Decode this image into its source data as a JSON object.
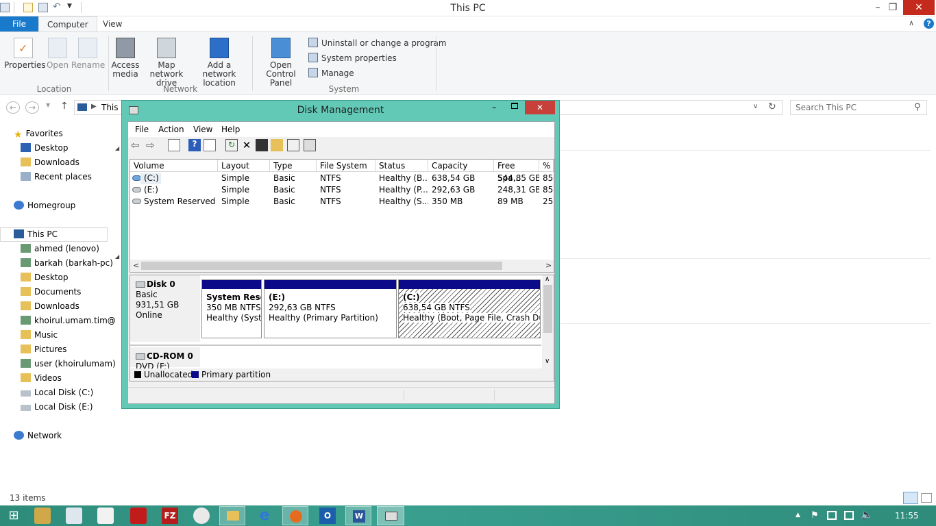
{
  "window": {
    "title": "This PC"
  },
  "window_controls": {
    "minimize": "–",
    "maximize": "❐",
    "close": "✕"
  },
  "ribbon": {
    "tabs": [
      "File",
      "Computer",
      "View"
    ],
    "location_group": {
      "label": "Location",
      "properties": "Properties",
      "open": "Open",
      "rename": "Rename"
    },
    "network_group": {
      "label": "Network",
      "access_media": "Access media",
      "map_drive": "Map network drive",
      "add_location": "Add a network location"
    },
    "system_group": {
      "label": "System",
      "open_control_panel": "Open Control Panel",
      "uninstall": "Uninstall or change a program",
      "system_properties": "System properties",
      "manage": "Manage"
    }
  },
  "address": {
    "path": "This P",
    "search_placeholder": "Search This PC"
  },
  "nav": {
    "favorites": "Favorites",
    "fav_items": [
      "Desktop",
      "Downloads",
      "Recent places"
    ],
    "homegroup": "Homegroup",
    "thispc": "This PC",
    "pc_items": [
      "ahmed (lenovo)",
      "barkah (barkah-pc)",
      "Desktop",
      "Documents",
      "Downloads",
      "khoirul.umam.tim@",
      "Music",
      "Pictures",
      "user (khoirulumam)",
      "Videos",
      "Local Disk (C:)",
      "Local Disk (E:)"
    ],
    "network": "Network"
  },
  "status": {
    "items": "13 items"
  },
  "taskbar": {
    "clock": "11:55"
  },
  "disk_management": {
    "title": "Disk Management",
    "menu": [
      "File",
      "Action",
      "View",
      "Help"
    ],
    "columns": [
      "Volume",
      "Layout",
      "Type",
      "File System",
      "Status",
      "Capacity",
      "Free Spa...",
      "% F"
    ],
    "rows": [
      [
        "(C:)",
        "Simple",
        "Basic",
        "NTFS",
        "Healthy (B...",
        "638,54 GB",
        "544,85 GB",
        "85"
      ],
      [
        "(E:)",
        "Simple",
        "Basic",
        "NTFS",
        "Healthy (P...",
        "292,63 GB",
        "248,31 GB",
        "85"
      ],
      [
        "System Reserved",
        "Simple",
        "Basic",
        "NTFS",
        "Healthy (S...",
        "350 MB",
        "89 MB",
        "25"
      ]
    ],
    "disk0": {
      "name": "Disk 0",
      "type": "Basic",
      "size": "931,51 GB",
      "state": "Online"
    },
    "partitions": [
      {
        "name": "System Reser",
        "size": "350 MB NTFS",
        "status": "Healthy (Syste"
      },
      {
        "name": "(E:)",
        "size": "292,63 GB NTFS",
        "status": "Healthy (Primary Partition)"
      },
      {
        "name": "(C:)",
        "size": "638,54 GB NTFS",
        "status": "Healthy (Boot, Page File, Crash Dump"
      }
    ],
    "cdrom": {
      "name": "CD-ROM 0",
      "type": "DVD (F:)"
    },
    "legend": {
      "unallocated": "Unallocated",
      "primary": "Primary partition"
    },
    "colors": {
      "primary": "#0b0b8a",
      "unallocated": "#000000",
      "frame": "#63c9b7"
    }
  }
}
